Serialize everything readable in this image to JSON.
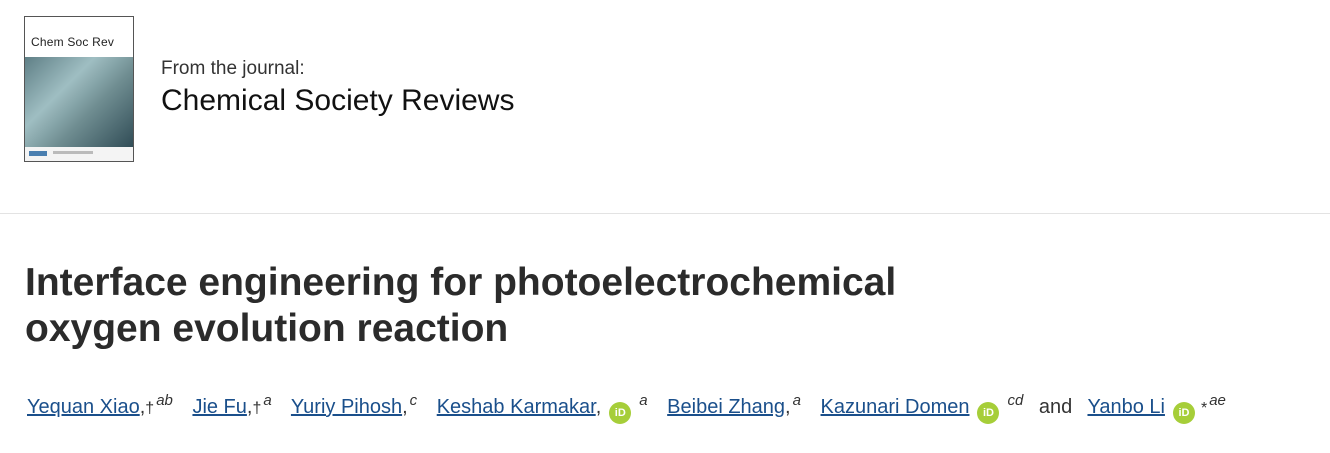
{
  "journal": {
    "cover_title": "Chem Soc Rev",
    "from_label": "From the journal:",
    "name": "Chemical Society Reviews"
  },
  "article": {
    "title_line1": "Interface engineering for photoelectrochemical",
    "title_line2": "oxygen evolution reaction"
  },
  "authors": [
    {
      "name": "Yequan Xiao",
      "marks": "†",
      "aff": "ab",
      "orcid": false
    },
    {
      "name": "Jie Fu",
      "marks": "†",
      "aff": "a",
      "orcid": false
    },
    {
      "name": "Yuriy Pihosh",
      "marks": "",
      "aff": "c",
      "orcid": false
    },
    {
      "name": "Keshab Karmakar",
      "marks": "",
      "aff": "a",
      "orcid": true
    },
    {
      "name": "Beibei Zhang",
      "marks": "",
      "aff": "a",
      "orcid": false
    },
    {
      "name": "Kazunari Domen",
      "marks": "",
      "aff": "cd",
      "orcid": true
    },
    {
      "name": "Yanbo Li",
      "marks": "*",
      "aff": "ae",
      "orcid": true
    }
  ],
  "and_word": "and",
  "orcid_icon": "iD",
  "colors": {
    "link": "#1a4f8b",
    "orcid": "#a6ce39",
    "title": "#2b2b2b"
  }
}
